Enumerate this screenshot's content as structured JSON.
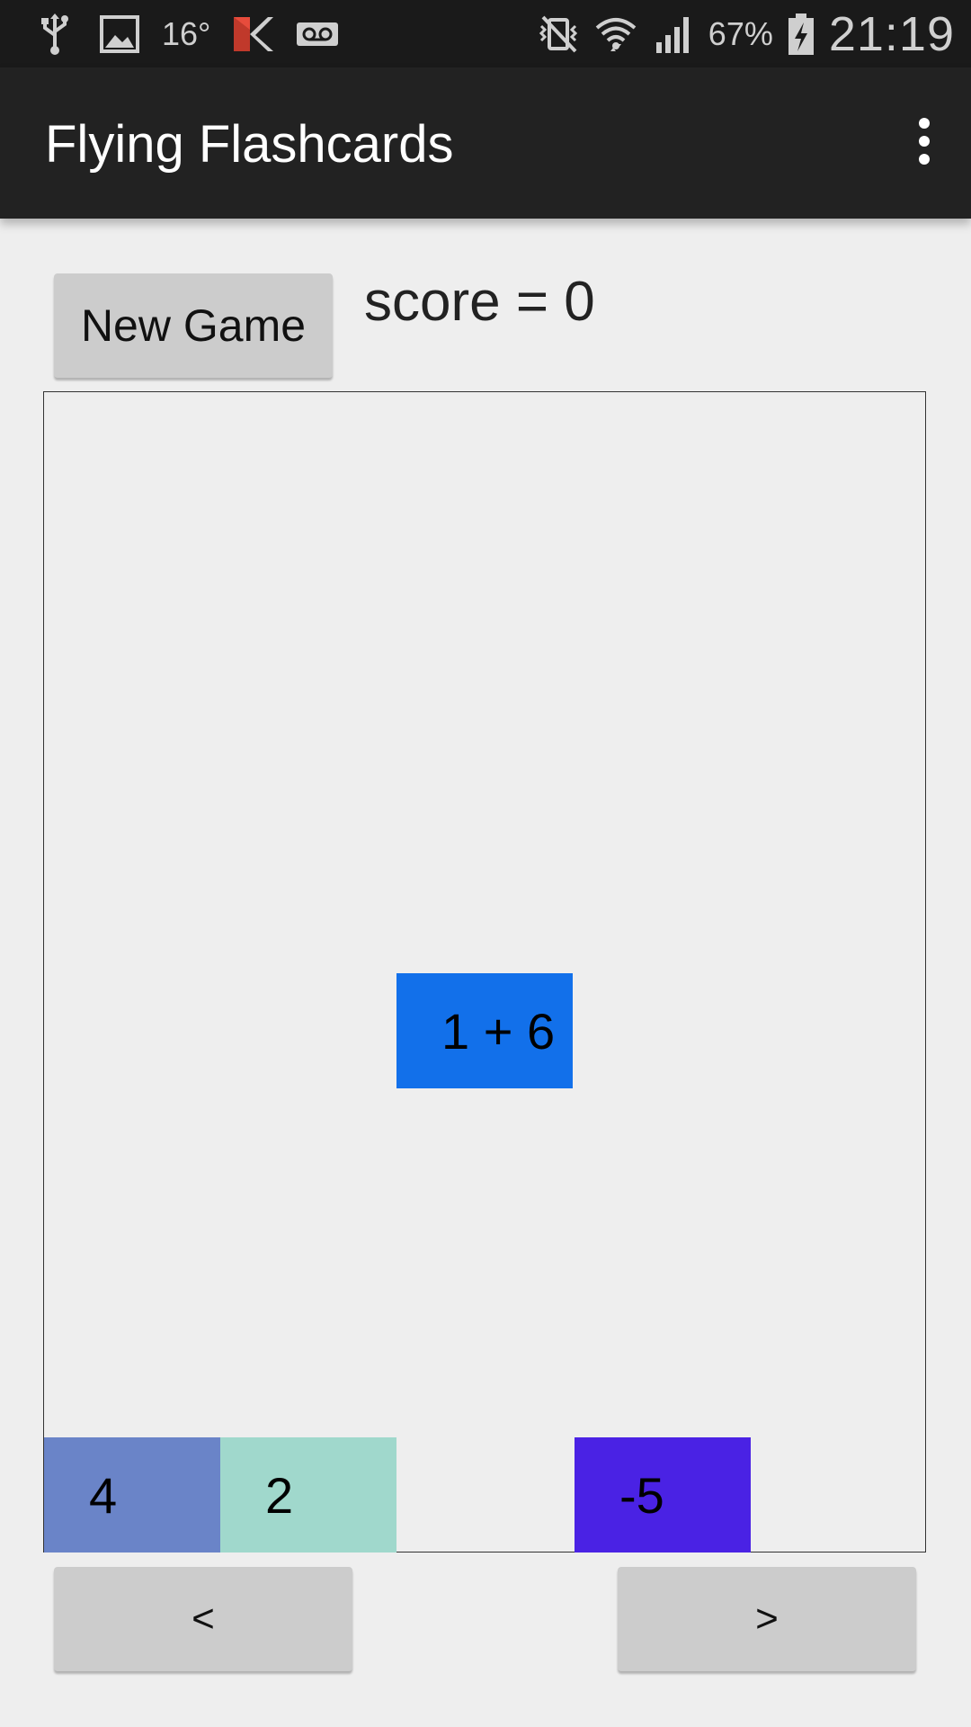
{
  "status_bar": {
    "temperature": "16°",
    "battery_percent": "67%",
    "time": "21:19",
    "icons": [
      "usb-icon",
      "image-icon",
      "kaspersky-icon",
      "voicemail-icon",
      "vibrate-icon",
      "wifi-icon",
      "signal-icon",
      "battery-charging-icon"
    ]
  },
  "app_bar": {
    "title": "Flying Flashcards",
    "overflow_icon": "overflow-menu-icon"
  },
  "controls": {
    "new_game_label": "New Game",
    "score_text": "score = 0"
  },
  "game": {
    "question": {
      "text": "1 + 6",
      "color": "#1270ea"
    },
    "answers": [
      {
        "text": "4",
        "color": "#6a84c8"
      },
      {
        "text": "2",
        "color": "#a0d8cc"
      },
      {
        "text": "-5",
        "color": "#4a22e4"
      }
    ]
  },
  "navigation": {
    "prev_label": "<",
    "next_label": ">"
  }
}
